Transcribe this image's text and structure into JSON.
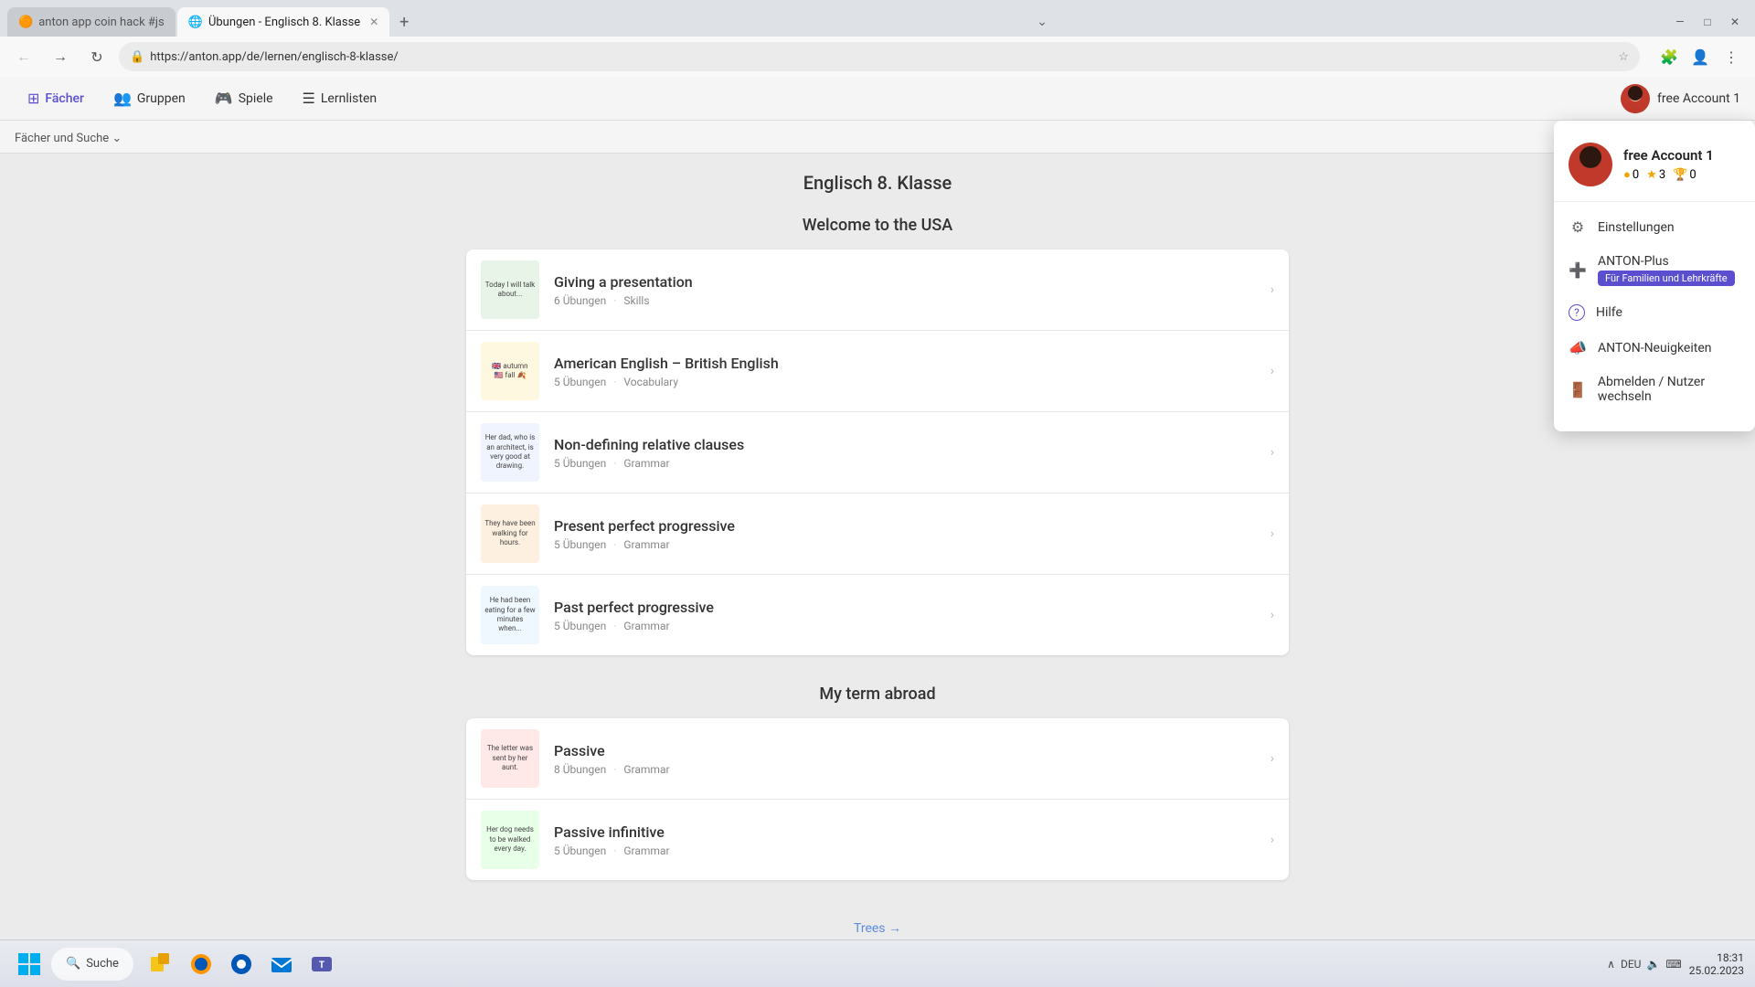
{
  "browser": {
    "tabs": [
      {
        "id": "tab1",
        "label": "anton app coin hack #js",
        "active": false,
        "icon": "🟠"
      },
      {
        "id": "tab2",
        "label": "Übungen - Englisch 8. Klasse",
        "active": true,
        "icon": "🌐"
      }
    ],
    "url": "https://anton.app/de/lernen/englisch-8-klasse/"
  },
  "nav": {
    "items": [
      {
        "id": "faecher",
        "label": "Fächer",
        "icon": "⊞",
        "active": true
      },
      {
        "id": "gruppen",
        "label": "Gruppen",
        "icon": "👥",
        "active": false
      },
      {
        "id": "spiele",
        "label": "Spiele",
        "icon": "🎮",
        "active": false
      },
      {
        "id": "lernlisten",
        "label": "Lernlisten",
        "icon": "☰",
        "active": false
      }
    ],
    "account": "free Account 1"
  },
  "breadcrumb": "Fächer und Suche",
  "page": {
    "title": "Englisch 8. Klasse",
    "sections": [
      {
        "id": "section1",
        "title": "Welcome to the USA",
        "exercises": [
          {
            "id": "ex1",
            "title": "Giving a presentation",
            "count": "6 Übungen",
            "category": "Skills",
            "thumb_text": "Today I will talk about..."
          },
          {
            "id": "ex2",
            "title": "American English – British English",
            "count": "5 Übungen",
            "category": "Vocabulary",
            "thumb_text": "🇬🇧 autumn\n🇺🇸 fall 🍂"
          },
          {
            "id": "ex3",
            "title": "Non-defining relative clauses",
            "count": "5 Übungen",
            "category": "Grammar",
            "thumb_text": "Her dad, who is an architect, is very good at drawing."
          },
          {
            "id": "ex4",
            "title": "Present perfect progressive",
            "count": "5 Übungen",
            "category": "Grammar",
            "thumb_text": "They have been walking for hours."
          },
          {
            "id": "ex5",
            "title": "Past perfect progressive",
            "count": "5 Übungen",
            "category": "Grammar",
            "thumb_text": "He had been eating for a few minutes when..."
          }
        ]
      },
      {
        "id": "section2",
        "title": "My term abroad",
        "exercises": [
          {
            "id": "ex6",
            "title": "Passive",
            "count": "8 Übungen",
            "category": "Grammar",
            "thumb_text": "The letter was sent by her aunt."
          },
          {
            "id": "ex7",
            "title": "Passive infinitive",
            "count": "5 Übungen",
            "category": "Grammar",
            "thumb_text": "Her dog needs to be walked every day."
          }
        ]
      }
    ],
    "trees_link": "Trees →"
  },
  "dropdown": {
    "visible": true,
    "name": "free Account 1",
    "stats": {
      "coins": "0",
      "stars": "3",
      "trophies": "0"
    },
    "menu_items": [
      {
        "id": "einstellungen",
        "label": "Einstellungen",
        "icon": "⚙"
      },
      {
        "id": "anton-plus",
        "label": "ANTON-Plus",
        "icon": "➕",
        "badge": "Für Familien und Lehrkräfte"
      },
      {
        "id": "hilfe",
        "label": "Hilfe",
        "icon": "?"
      },
      {
        "id": "neuigkeiten",
        "label": "ANTON-Neuigkeiten",
        "icon": "📣"
      },
      {
        "id": "abmelden",
        "label": "Abmelden / Nutzer wechseln",
        "icon": "🚪"
      }
    ]
  },
  "taskbar": {
    "search_label": "Suche",
    "time": "18:31",
    "date": "25.02.2023",
    "lang": "DEU"
  }
}
